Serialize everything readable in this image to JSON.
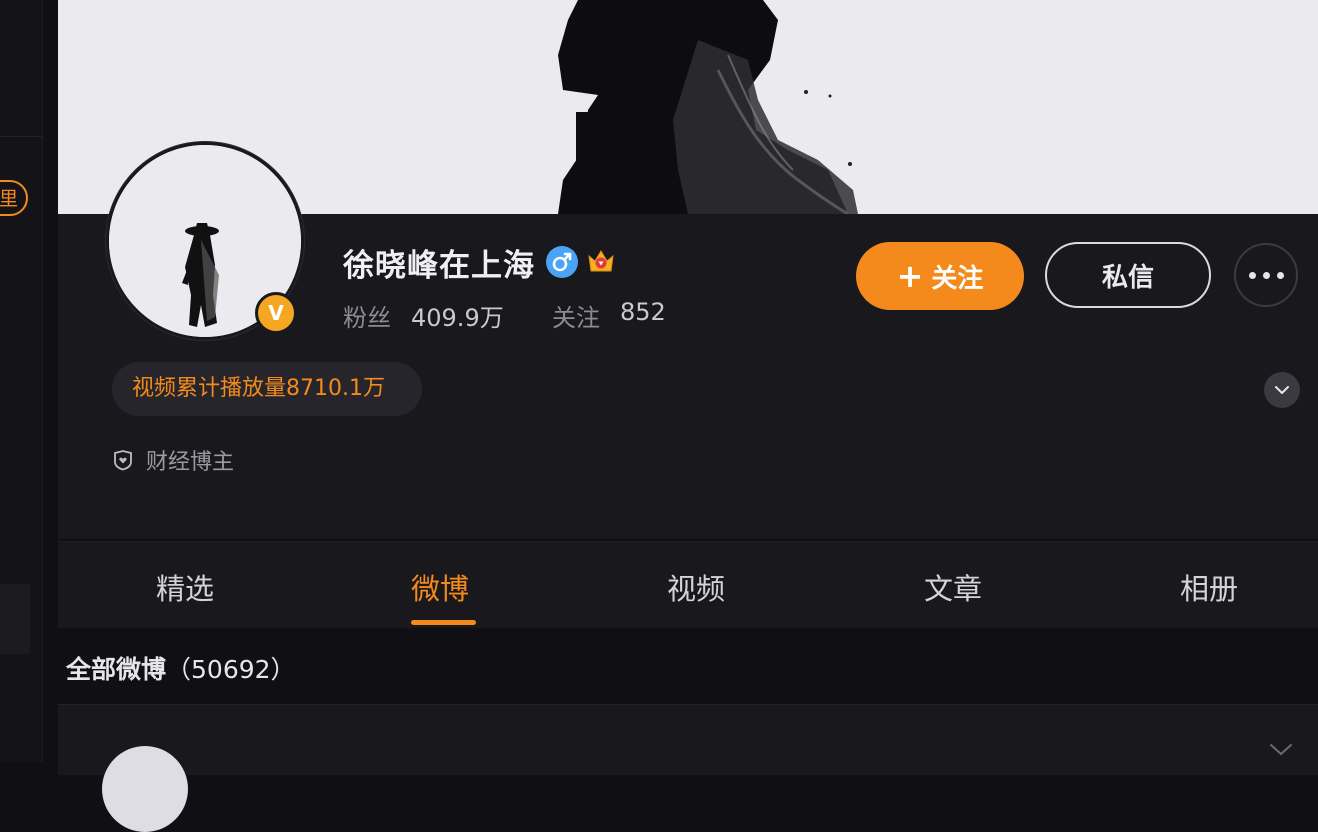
{
  "sidebar": {
    "pill_label": "里"
  },
  "profile": {
    "name": "徐晓峰在上海",
    "verified_badge": "V",
    "gender_icon": "male-icon",
    "fans_label": "粉丝",
    "fans_value": "409.9万",
    "following_label": "关注",
    "following_value": "852",
    "play_count_text": "视频累计播放量8710.1万",
    "tag_text": "财经博主"
  },
  "actions": {
    "follow_label": "关注",
    "follow_plus": "+",
    "message_label": "私信",
    "more_icon": "more-dots-icon"
  },
  "tabs": [
    {
      "label": "精选",
      "active": false
    },
    {
      "label": "微博",
      "active": true
    },
    {
      "label": "视频",
      "active": false
    },
    {
      "label": "文章",
      "active": false
    },
    {
      "label": "相册",
      "active": false
    }
  ],
  "feed": {
    "title": "全部微博",
    "count": "（50692）"
  },
  "colors": {
    "accent": "#f48a1b",
    "background": "#101014",
    "card": "#18181d",
    "verified": "#f5a623",
    "gender": "#4aa3f5"
  }
}
